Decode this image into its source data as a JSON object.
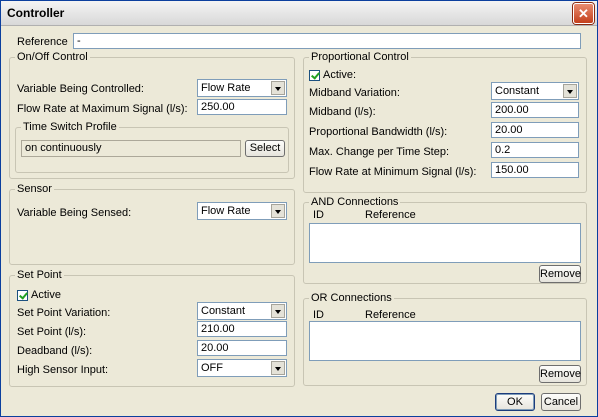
{
  "window": {
    "title": "Controller",
    "close": "✕"
  },
  "reference": {
    "label": "Reference",
    "value": "-"
  },
  "onoff": {
    "title": "On/Off Control",
    "var_label": "Variable Being Controlled:",
    "var_value": "Flow Rate",
    "flow_label": "Flow Rate at Maximum Signal (l/s):",
    "flow_value": "250.00",
    "time_switch": {
      "title": "Time Switch Profile",
      "value": "on continuously",
      "select_label": "Select"
    }
  },
  "sensor": {
    "title": "Sensor",
    "var_label": "Variable Being Sensed:",
    "var_value": "Flow Rate"
  },
  "setpoint": {
    "title": "Set Point",
    "active_label": "Active",
    "variation_label": "Set Point Variation:",
    "variation_value": "Constant",
    "setpoint_label": "Set Point (l/s):",
    "setpoint_value": "210.00",
    "deadband_label": "Deadband (l/s):",
    "deadband_value": "20.00",
    "high_label": "High Sensor Input:",
    "high_value": "OFF"
  },
  "proportional": {
    "title": "Proportional Control",
    "active_label": "Active:",
    "midvar_label": "Midband Variation:",
    "midvar_value": "Constant",
    "midband_label": "Midband (l/s):",
    "midband_value": "200.00",
    "bandwidth_label": "Proportional Bandwidth (l/s):",
    "bandwidth_value": "20.00",
    "maxchange_label": "Max. Change per Time Step:",
    "maxchange_value": "0.2",
    "minflow_label": "Flow Rate at Minimum Signal (l/s):",
    "minflow_value": "150.00"
  },
  "and_conn": {
    "title": "AND Connections",
    "col_id": "ID",
    "col_ref": "Reference",
    "remove": "Remove"
  },
  "or_conn": {
    "title": "OR Connections",
    "col_id": "ID",
    "col_ref": "Reference",
    "remove": "Remove"
  },
  "footer": {
    "ok": "OK",
    "cancel": "Cancel"
  },
  "colors": {
    "accent": "#0b3f9e",
    "close": "#c4401c",
    "checkmark": "#21a121"
  }
}
